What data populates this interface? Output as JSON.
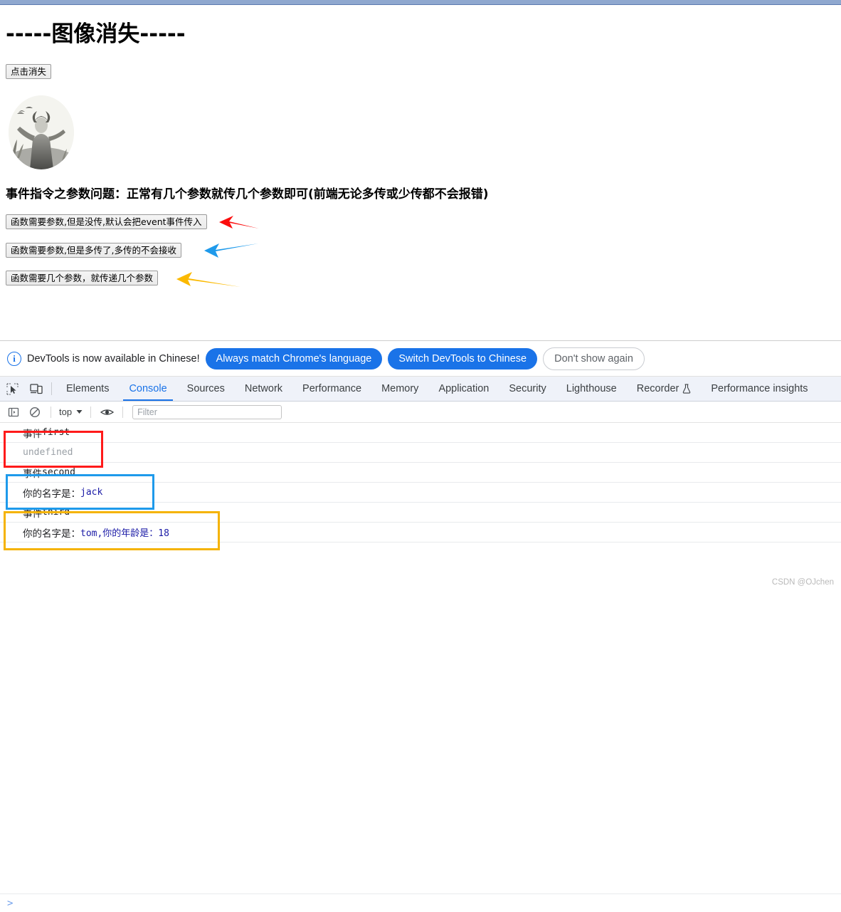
{
  "page": {
    "heading": "-----图像消失-----",
    "hide_button_label": "点击消失",
    "avatar_alt": "grayscale-anime-illustration",
    "param_note": "事件指令之参数问题：正常有几个参数就传几个参数即可(前端无论多传或少传都不会报错)",
    "buttons": [
      {
        "label": "函数需要参数,但是没传,默认会把event事件传入",
        "arrow_color": "#ff1a1a"
      },
      {
        "label": "函数需要参数,但是多传了,多传的不会接收",
        "arrow_color": "#1e9aeb"
      },
      {
        "label": "函数需要几个参数，就传递几个参数",
        "arrow_color": "#f5b301"
      }
    ]
  },
  "devtools": {
    "infobar": {
      "icon": "info-circle-icon",
      "message": "DevTools is now available in Chinese!",
      "primary_button": "Always match Chrome's language",
      "secondary_button": "Switch DevTools to Chinese",
      "dismiss_button": "Don't show again"
    },
    "toolbar_icons": [
      {
        "name": "inspect-element-icon"
      },
      {
        "name": "device-toolbar-icon"
      }
    ],
    "tabs": [
      {
        "label": "Elements",
        "active": false
      },
      {
        "label": "Console",
        "active": true
      },
      {
        "label": "Sources",
        "active": false
      },
      {
        "label": "Network",
        "active": false
      },
      {
        "label": "Performance",
        "active": false
      },
      {
        "label": "Memory",
        "active": false
      },
      {
        "label": "Application",
        "active": false
      },
      {
        "label": "Security",
        "active": false
      },
      {
        "label": "Lighthouse",
        "active": false
      },
      {
        "label": "Recorder",
        "active": false,
        "icon": "flask-icon"
      },
      {
        "label": "Performance insights",
        "active": false
      }
    ],
    "console_toolbar": {
      "sidebar_toggle_icon": "sidebar-panel-icon",
      "clear_icon": "clear-console-icon",
      "context": "top",
      "context_chevron": "chevron-down-icon",
      "eye_icon": "live-expression-icon",
      "filter_placeholder": "Filter",
      "filter_value": ""
    },
    "console_rows": [
      {
        "cjk": "事件",
        "mono": "first",
        "dim": false,
        "value": null
      },
      {
        "cjk": "",
        "mono": "undefined",
        "dim": true,
        "value": null
      },
      {
        "cjk": "事件",
        "mono": "second",
        "dim": false,
        "value": null
      },
      {
        "cjk": "你的名字是：",
        "mono": "",
        "dim": false,
        "value": "jack"
      },
      {
        "cjk": "事件",
        "mono": "third",
        "dim": false,
        "value": null
      },
      {
        "cjk": "你的名字是：",
        "mono": "",
        "dim": false,
        "value": "tom,你的年龄是：18"
      }
    ],
    "prompt_caret": ">"
  },
  "watermark": "CSDN @OJchen"
}
